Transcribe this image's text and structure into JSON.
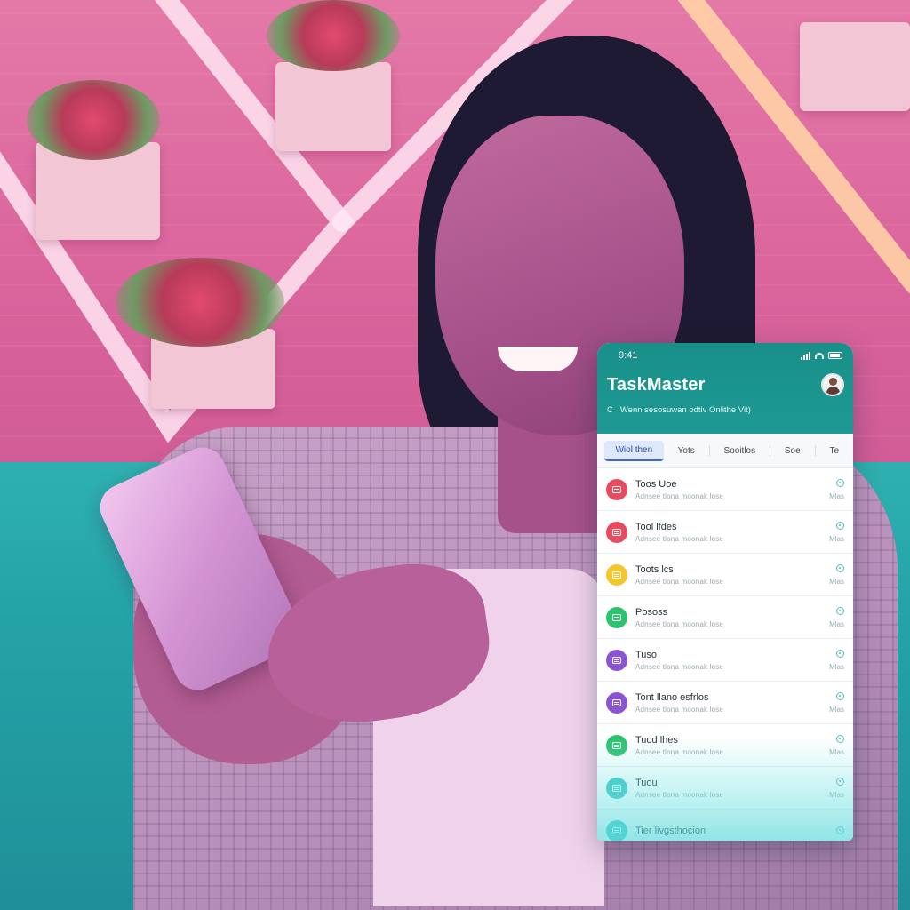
{
  "status_bar": {
    "time": "9:41"
  },
  "app": {
    "title": "TaskMaster",
    "subtitle_icon": "C",
    "subtitle": "Wenn sesosuwan odtiv Onlithe Vit)"
  },
  "tabs": [
    {
      "label": "Wiol then",
      "active": true
    },
    {
      "label": "Yots",
      "active": false
    },
    {
      "label": "Sooitlos",
      "active": false
    },
    {
      "label": "Soe",
      "active": false
    },
    {
      "label": "Te",
      "active": false
    }
  ],
  "tasks": [
    {
      "title": "Toos Uoe",
      "subtitle": "Adnsee tlona moonak lose",
      "time": "Mlas",
      "color": "#e84a5f",
      "icon": "calendar-icon"
    },
    {
      "title": "Tool lfdes",
      "subtitle": "Adnsee tlona moonak lose",
      "time": "Mlas",
      "color": "#e84a5f",
      "icon": "calendar-icon"
    },
    {
      "title": "Toots lcs",
      "subtitle": "Adnsee tlona moonak lose",
      "time": "Mlas",
      "color": "#f5c531",
      "icon": "calendar-icon"
    },
    {
      "title": "Pososs",
      "subtitle": "Adnsee tlona moonak lose",
      "time": "Mlas",
      "color": "#2ec270",
      "icon": "calendar-icon"
    },
    {
      "title": "Tuso",
      "subtitle": "Adnsee tlona moonak lose",
      "time": "Mlas",
      "color": "#8b54d6",
      "icon": "calendar-icon"
    },
    {
      "title": "Tont llano esfrlos",
      "subtitle": "Adnsee tlona moonak lose",
      "time": "Mlas",
      "color": "#8b54d6",
      "icon": "calendar-icon"
    },
    {
      "title": "Tuod lhes",
      "subtitle": "Adnsee tlona moonak lose",
      "time": "Mlas",
      "color": "#2ec270",
      "icon": "calendar-icon"
    },
    {
      "title": "Tuou",
      "subtitle": "Adnsee tlona moonak lose",
      "time": "Mlas",
      "color": "#3cc7c4",
      "icon": "calendar-icon"
    },
    {
      "title": "Tier livgsthocion",
      "subtitle": "",
      "time": "",
      "color": "#3cc7c4",
      "icon": "calendar-icon"
    }
  ]
}
